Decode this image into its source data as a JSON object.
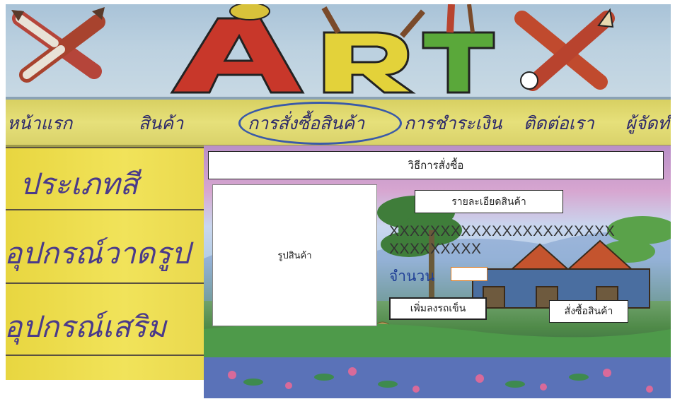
{
  "banner": {
    "logo_text": "ARTX"
  },
  "nav": {
    "items": [
      {
        "label": "หน้าแรก"
      },
      {
        "label": "สินค้า"
      },
      {
        "label": "การสั่งซื้อสินค้า",
        "active": true
      },
      {
        "label": "การชำระเงิน"
      },
      {
        "label": "ติดต่อเรา"
      },
      {
        "label": "ผู้จัดทำ"
      }
    ]
  },
  "sidebar": {
    "categories": [
      {
        "label": "ประเภทสี"
      },
      {
        "label": "อุปกรณ์วาดรูป"
      },
      {
        "label": "อุปกรณ์เสริม"
      }
    ]
  },
  "main": {
    "howto_label": "วิธีการสั่งซื้อ",
    "product_image_label": "รูปสินค้า",
    "details_button": "รายละเอียดสินค้า",
    "description_line1": "XXXXXXXXXXXXXXXXXXXXXX",
    "description_line2": "XXXXXXXXX",
    "quantity_label": "จำนวน",
    "quantity_value": "",
    "add_to_cart_button": "เพิ่มลงรถเข็น",
    "order_button": "สั่งซื้อสินค้า"
  },
  "colors": {
    "banner_sky": "#bcd1e0",
    "nav_yellow": "#e6e07a",
    "sidebar_yellow": "#f1e35a",
    "active_circle": "#3a5aa8",
    "letter_red": "#c8372a",
    "letter_yellow": "#e3d23a",
    "letter_green": "#5aa83a"
  }
}
